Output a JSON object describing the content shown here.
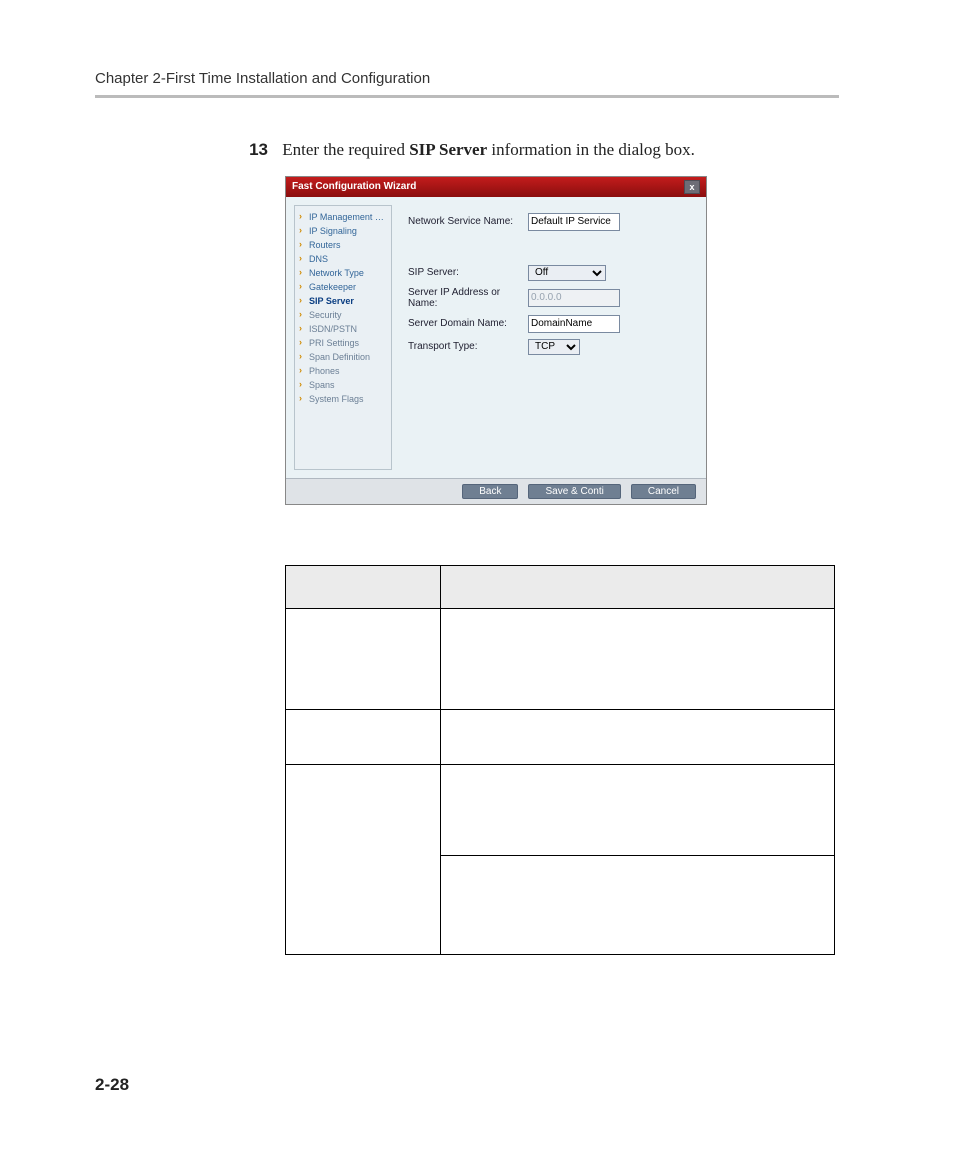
{
  "running_head": "Chapter 2-First Time Installation and Configuration",
  "step": {
    "number": "13",
    "lead": "Enter the required ",
    "bold": "SIP Server",
    "tail": " information in the dialog box."
  },
  "dialog": {
    "title": "Fast Configuration Wizard",
    "close": "x",
    "nav": [
      {
        "label": "IP Management Service",
        "state": ""
      },
      {
        "label": "IP Signaling",
        "state": ""
      },
      {
        "label": "Routers",
        "state": ""
      },
      {
        "label": "DNS",
        "state": ""
      },
      {
        "label": "Network Type",
        "state": ""
      },
      {
        "label": "Gatekeeper",
        "state": ""
      },
      {
        "label": "SIP Server",
        "state": "current"
      },
      {
        "label": "Security",
        "state": "done"
      },
      {
        "label": "ISDN/PSTN",
        "state": "done"
      },
      {
        "label": "PRI Settings",
        "state": "done"
      },
      {
        "label": "Span Definition",
        "state": "done"
      },
      {
        "label": "Phones",
        "state": "done"
      },
      {
        "label": "Spans",
        "state": "done"
      },
      {
        "label": "System Flags",
        "state": "done"
      }
    ],
    "fields": {
      "service_name_label": "Network Service Name:",
      "service_name_value": "Default IP Service",
      "sip_server_label": "SIP Server:",
      "sip_server_value": "Off",
      "ip_label": "Server IP Address or Name:",
      "ip_value": "0.0.0.0",
      "domain_label": "Server Domain Name:",
      "domain_value": "DomainName",
      "transport_label": "Transport Type:",
      "transport_value": "TCP"
    },
    "buttons": {
      "back": "Back",
      "save": "Save & Conti",
      "cancel": "Cancel"
    }
  },
  "page_number": "2-28"
}
